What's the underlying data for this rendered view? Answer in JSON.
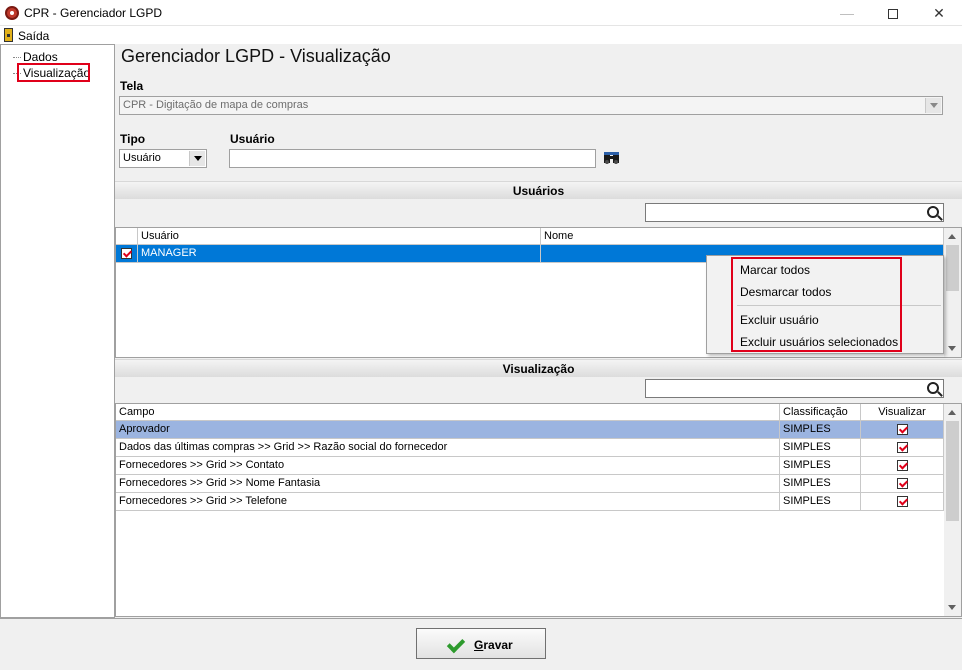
{
  "window": {
    "title": "CPR - Gerenciador LGPD",
    "minimize": "—",
    "close": "✕"
  },
  "menu": {
    "exit_label": "Saída"
  },
  "nav": {
    "items": [
      {
        "label": "Dados"
      },
      {
        "label": "Visualização"
      }
    ]
  },
  "page": {
    "title": "Gerenciador LGPD - Visualização"
  },
  "tela": {
    "label": "Tela",
    "value": "CPR - Digitação de mapa de compras"
  },
  "tipo": {
    "label": "Tipo",
    "value": "Usuário"
  },
  "usuario": {
    "label": "Usuário",
    "value": ""
  },
  "usuarios_section": {
    "title": "Usuários",
    "columns": [
      "Usuário",
      "Nome"
    ],
    "rows": [
      {
        "checked": true,
        "usuario": "MANAGER",
        "nome": ""
      }
    ]
  },
  "context_menu": {
    "items": [
      "Marcar todos",
      "Desmarcar todos",
      "Excluir usuário",
      "Excluir usuários selecionados"
    ]
  },
  "visualizacao_section": {
    "title": "Visualização",
    "columns": [
      "Campo",
      "Classificação",
      "Visualizar"
    ],
    "rows": [
      {
        "campo": "Aprovador",
        "classificacao": "SIMPLES",
        "visualizar": true
      },
      {
        "campo": "Dados das últimas compras >> Grid >> Razão social do fornecedor",
        "classificacao": "SIMPLES",
        "visualizar": true
      },
      {
        "campo": "Fornecedores >> Grid >> Contato",
        "classificacao": "SIMPLES",
        "visualizar": true
      },
      {
        "campo": "Fornecedores >> Grid >> Nome Fantasia",
        "classificacao": "SIMPLES",
        "visualizar": true
      },
      {
        "campo": "Fornecedores >> Grid >> Telefone",
        "classificacao": "SIMPLES",
        "visualizar": true
      }
    ]
  },
  "footer": {
    "save_label_first": "G",
    "save_label_rest": "ravar"
  },
  "colors": {
    "selection": "#0078d7",
    "selection_light": "#9bb4e0",
    "highlight": "#e0001a"
  }
}
